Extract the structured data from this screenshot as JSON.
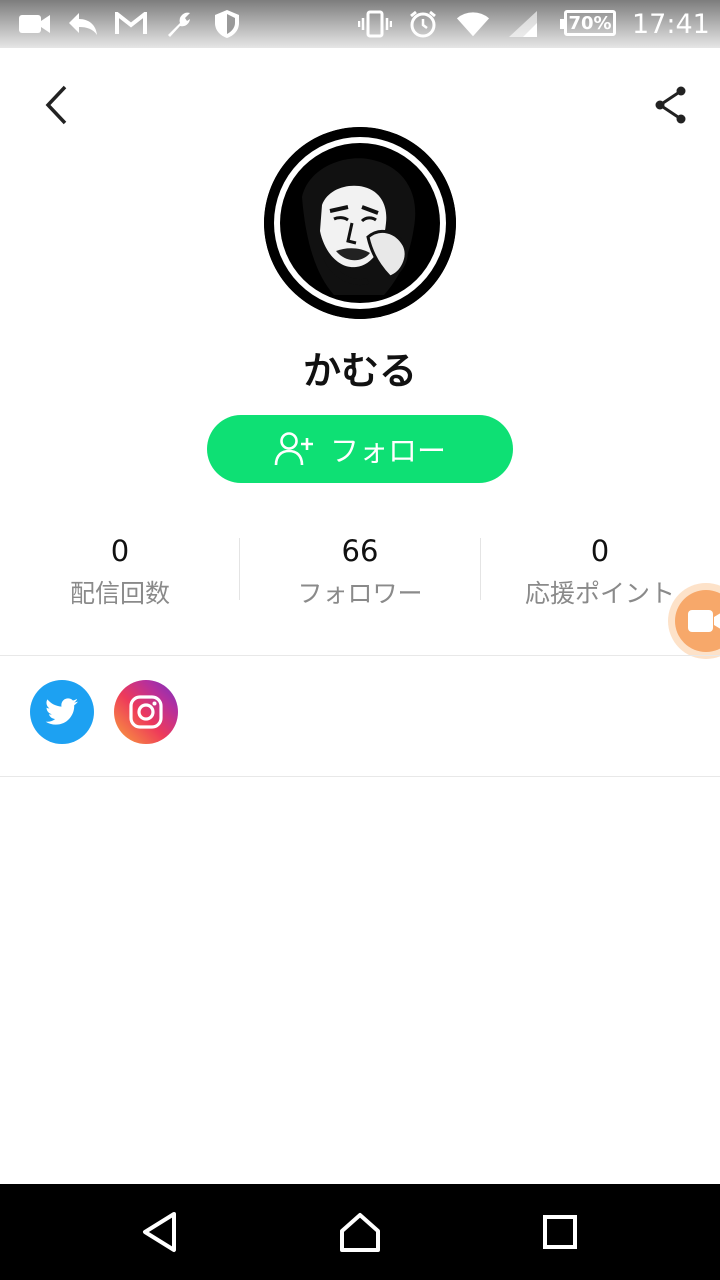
{
  "status_bar": {
    "battery": "70%",
    "time": "17:41",
    "icons": [
      "video-icon",
      "reply-icon",
      "gmail-icon",
      "wrench-icon",
      "shield-icon",
      "vibrate-icon",
      "alarm-icon",
      "wifi-icon",
      "signal-icon",
      "battery-icon"
    ]
  },
  "header": {
    "back_icon": "back-chevron-icon",
    "share_icon": "share-icon"
  },
  "profile": {
    "name": "かむる",
    "follow_label": "フォロー",
    "follow_color": "#0ee074"
  },
  "stats": [
    {
      "value": "0",
      "label": "配信回数"
    },
    {
      "value": "66",
      "label": "フォロワー"
    },
    {
      "value": "0",
      "label": "応援ポイント"
    }
  ],
  "social": [
    {
      "name": "twitter",
      "icon": "twitter-icon",
      "color": "#1da1f2"
    },
    {
      "name": "instagram",
      "icon": "instagram-icon"
    }
  ],
  "nav_bar": {
    "icons": [
      "back-triangle-icon",
      "home-icon",
      "recents-icon"
    ]
  }
}
